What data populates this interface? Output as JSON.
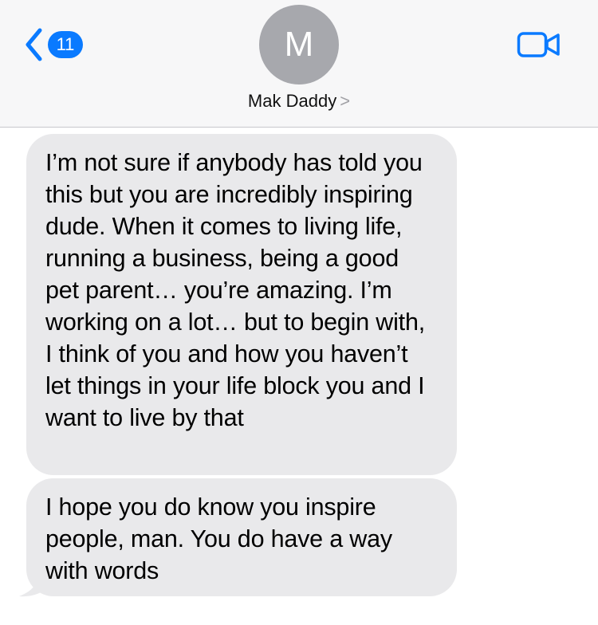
{
  "header": {
    "back_badge": "11",
    "avatar_initial": "M",
    "contact_name": "Mak Daddy",
    "contact_chevron": ">"
  },
  "messages": [
    {
      "direction": "incoming",
      "text": "I’m not sure if anybody has told you this but you are incredibly inspiring dude. When it comes to living life, running a business, being a good pet parent… you’re amazing. I’m working on a lot… but to begin with, I think of you and how you haven’t let things in your life block you and I want to live by that"
    },
    {
      "direction": "incoming",
      "text": "I hope you do know you inspire people, man. You do have a way with words"
    }
  ],
  "colors": {
    "accent": "#0a7aff",
    "header_bg": "#f7f7f8",
    "avatar_bg": "#a7a8ad",
    "incoming_bubble": "#e9e9eb"
  },
  "icons": {
    "back": "chevron-left-icon",
    "video": "video-camera-icon"
  }
}
